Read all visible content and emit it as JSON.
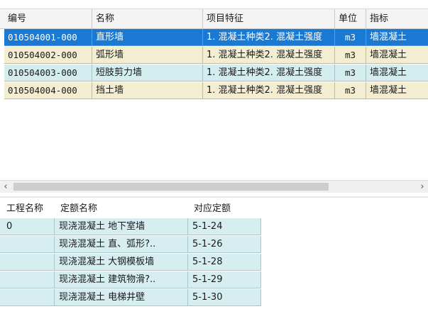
{
  "boq_table": {
    "columns": [
      "编号",
      "名称",
      "项目特征",
      "单位",
      "指标"
    ],
    "rows": [
      {
        "code": "010504001-000",
        "name": "直形墙",
        "features": "1. 混凝土种类2. 混凝土强度",
        "unit": "m3",
        "indicator": "墙混凝土",
        "selected": true
      },
      {
        "code": "010504002-000",
        "name": "弧形墙",
        "features": "1. 混凝土种类2. 混凝土强度",
        "unit": "m3",
        "indicator": "墙混凝土",
        "selected": false
      },
      {
        "code": "010504003-000",
        "name": "短肢剪力墙",
        "features": "1. 混凝土种类2. 混凝土强度",
        "unit": "m3",
        "indicator": "墙混凝土",
        "selected": false
      },
      {
        "code": "010504004-000",
        "name": "挡土墙",
        "features": "1. 混凝土种类2. 混凝土强度",
        "unit": "m3",
        "indicator": "墙混凝土",
        "selected": false
      }
    ]
  },
  "scrollbar": {
    "left_arrow": "‹",
    "right_arrow": "›"
  },
  "quota_table": {
    "columns": [
      "工程名称",
      "定额名称",
      "对应定额"
    ],
    "rows": [
      {
        "project": "0",
        "name": "现浇混凝土 地下室墙",
        "code": "5-1-24"
      },
      {
        "project": "",
        "name": "现浇混凝土 直、弧形?..",
        "code": "5-1-26"
      },
      {
        "project": "",
        "name": "现浇混凝土 大钢模板墙",
        "code": "5-1-28"
      },
      {
        "project": "",
        "name": "现浇混凝土 建筑物滑?..",
        "code": "5-1-29"
      },
      {
        "project": "",
        "name": "现浇混凝土 电梯井壁",
        "code": "5-1-30"
      }
    ]
  },
  "colors": {
    "selected_row": "#1979d3",
    "cream_row": "#f3eed2",
    "cyan_row": "#d4eeef"
  }
}
